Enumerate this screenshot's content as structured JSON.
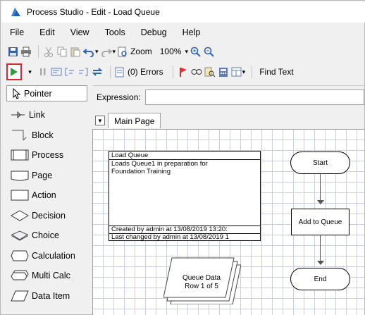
{
  "window": {
    "title": "Process Studio  - Edit - Load Queue"
  },
  "menu": [
    "File",
    "Edit",
    "View",
    "Tools",
    "Debug",
    "Help"
  ],
  "toolbar1": {
    "zoom_label": "Zoom",
    "zoom_value": "100%"
  },
  "toolbar2": {
    "errors_label": "(0) Errors",
    "find_text_label": "Find Text"
  },
  "tools": [
    {
      "label": "Pointer",
      "icon": "pointer-icon"
    },
    {
      "label": "Link",
      "icon": "link-icon"
    },
    {
      "label": "Block",
      "icon": "block-icon"
    },
    {
      "label": "Process",
      "icon": "process-icon"
    },
    {
      "label": "Page",
      "icon": "page-icon"
    },
    {
      "label": "Action",
      "icon": "action-icon"
    },
    {
      "label": "Decision",
      "icon": "decision-icon"
    },
    {
      "label": "Choice",
      "icon": "choice-icon"
    },
    {
      "label": "Calculation",
      "icon": "calculation-icon"
    },
    {
      "label": "Multi Calc",
      "icon": "multi-calc-icon"
    },
    {
      "label": "Data Item",
      "icon": "data-item-icon"
    }
  ],
  "expression": {
    "label": "Expression:",
    "value": ""
  },
  "tab": {
    "label": "Main Page"
  },
  "note": {
    "title": "Load Queue",
    "description": "Loads Queue1 in preparation for Foundation Training",
    "created": "Created  by  admin  at  13/08/2019 13:20:",
    "changed": "Last changed by admin at 13/08/2019 1"
  },
  "stages": {
    "start": "Start",
    "action": "Add to Queue",
    "end": "End"
  },
  "data_item": {
    "line1": "Queue Data",
    "line2": "Row 1 of 5"
  },
  "colors": {
    "run_green": "#2e9d3a",
    "run_highlight": "#e2252b",
    "grid": "#c9cfe0"
  }
}
